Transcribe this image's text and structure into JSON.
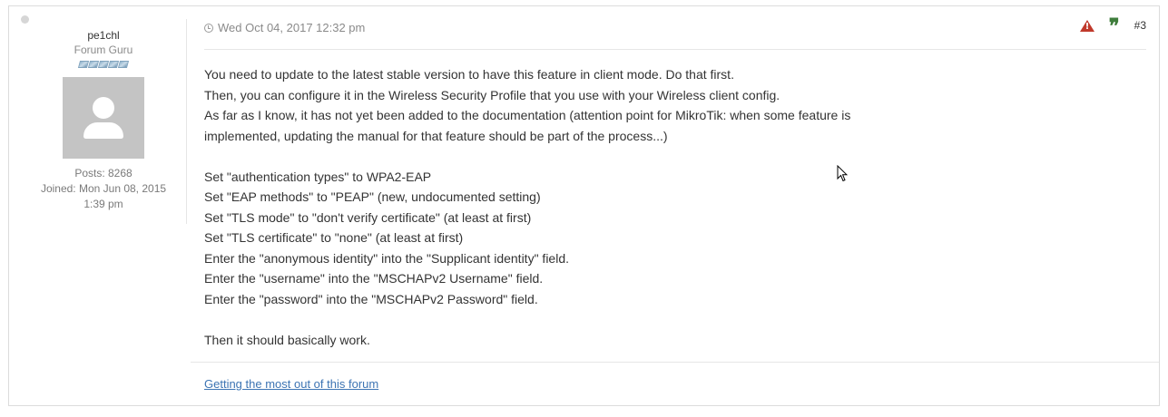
{
  "author": {
    "username": "pe1chl",
    "rank": "Forum Guru",
    "posts": "Posts: 8268",
    "joined": "Joined: Mon Jun 08, 2015",
    "joined_time": "1:39 pm"
  },
  "post": {
    "date": "Wed Oct 04, 2017 12:32 pm",
    "number": "#3",
    "quote_symbol": "❞",
    "lines": [
      "You need to update to the latest stable version to have this feature in client mode. Do that first.",
      "Then, you can configure it in the Wireless Security Profile that you use with your Wireless client config.",
      "As far as I know, it has not yet been added to the documentation (attention point for MikroTik: when some feature is",
      "implemented, updating the manual for that feature should be part of the process...)",
      "",
      "Set \"authentication types\" to WPA2-EAP",
      "Set \"EAP methods\" to \"PEAP\" (new, undocumented setting)",
      "Set \"TLS mode\" to \"don't verify certificate\" (at least at first)",
      "Set \"TLS certificate\" to \"none\" (at least at first)",
      "Enter the \"anonymous identity\" into the \"Supplicant identity\" field.",
      "Enter the \"username\" into the \"MSCHAPv2 Username\" field.",
      "Enter the \"password\" into the \"MSCHAPv2 Password\" field.",
      "",
      "Then it should basically work."
    ]
  },
  "signature": {
    "link_text": "Getting the most out of this forum"
  },
  "icons": {
    "report": "warning-triangle-icon",
    "quote": "quote-icon",
    "clock": "clock-icon"
  },
  "colors": {
    "report": "#c0392b",
    "quote": "#3e7d3b",
    "link": "#3d74b3"
  }
}
